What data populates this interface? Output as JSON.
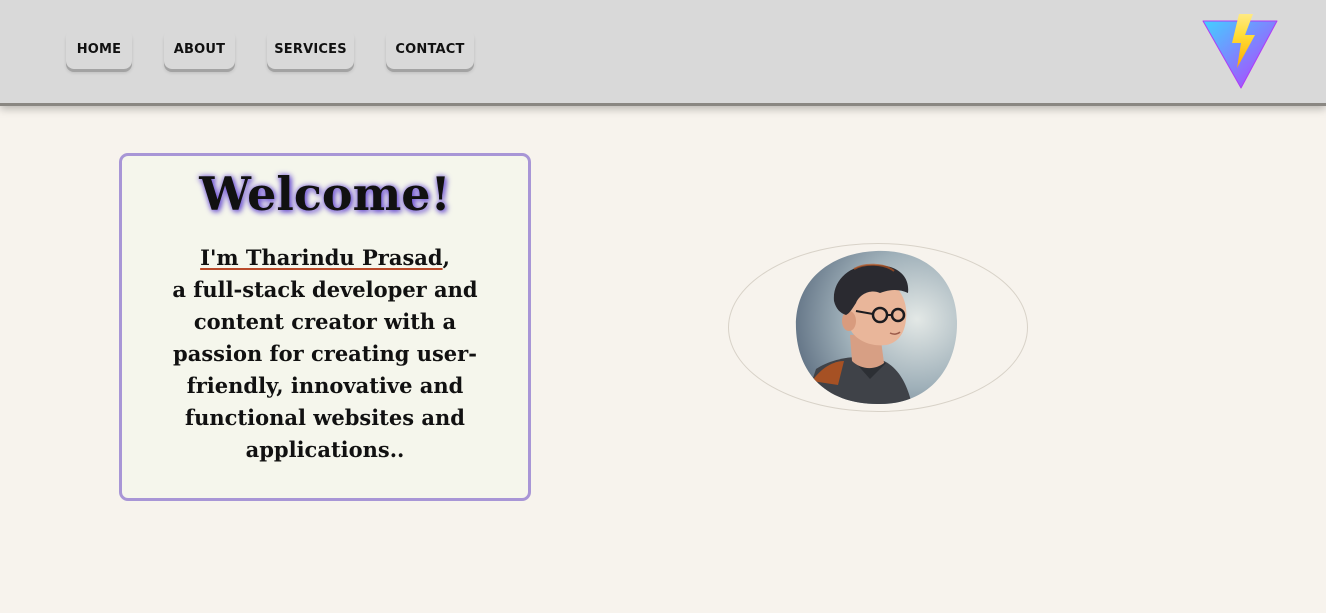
{
  "nav": {
    "items": [
      {
        "label": "HOME"
      },
      {
        "label": "ABOUT"
      },
      {
        "label": "SERVICES"
      },
      {
        "label": "CONTACT"
      }
    ]
  },
  "logo": {
    "icon": "vite-logo-icon"
  },
  "hero": {
    "title": "Welcome!",
    "name": "I'm Tharindu Prasad",
    "name_suffix": ",",
    "description": "a full-stack developer and content creator with a passion for creating user-friendly, innovative and functional websites and applications.."
  },
  "profile": {
    "icon": "profile-avatar-illustration"
  },
  "colors": {
    "background": "#f7f3ed",
    "navbar": "#d9d9d9",
    "card_border": "#a896d6",
    "card_background": "#f5f6ec",
    "title_glow": "#7b5fe0"
  }
}
